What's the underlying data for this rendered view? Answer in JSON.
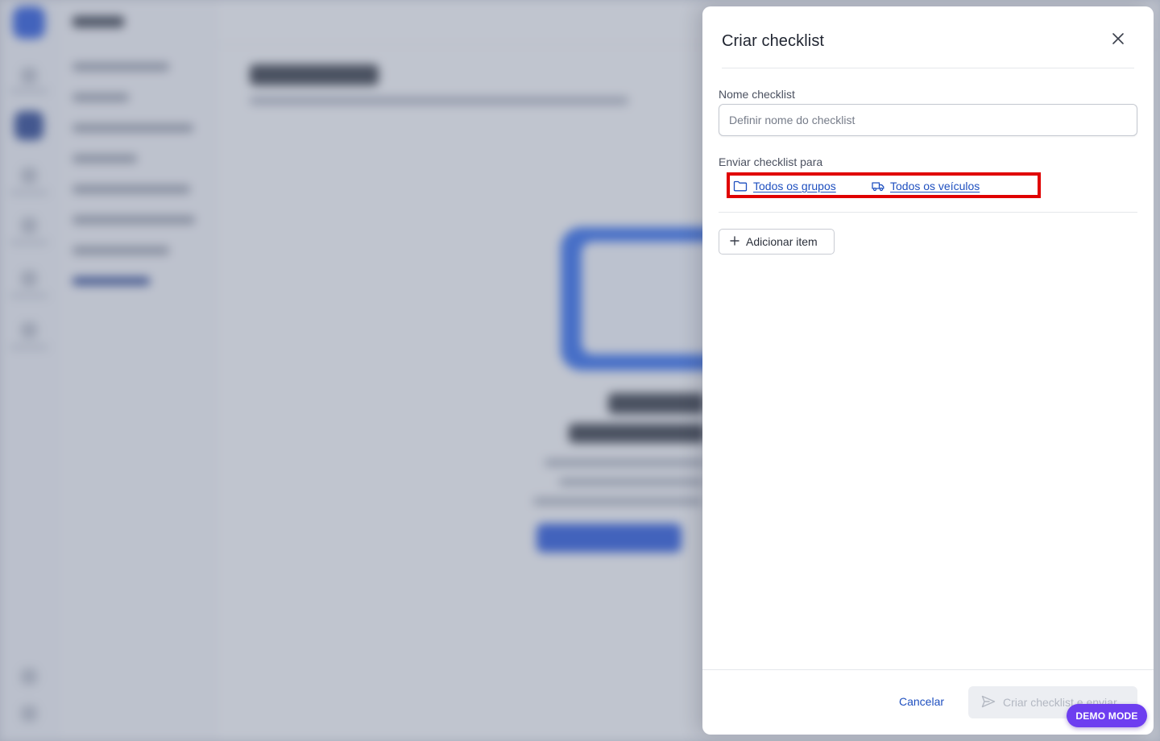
{
  "modal": {
    "title": "Criar checklist",
    "name_field": {
      "label": "Nome checklist",
      "placeholder": "Definir nome do checklist",
      "value": ""
    },
    "recipients": {
      "label": "Enviar checklist para",
      "groups_link": "Todos os grupos",
      "vehicles_link": "Todos os veículos"
    },
    "add_item_label": "Adicionar item",
    "footer": {
      "cancel_label": "Cancelar",
      "submit_label": "Criar checklist e enviar"
    }
  },
  "demo_badge": "DEMO MODE",
  "colors": {
    "link": "#1e4fbf",
    "highlight_box": "#e00000",
    "demo_badge": "#6d3ef0"
  },
  "icons": [
    "close-icon",
    "folder-icon",
    "truck-icon",
    "plus-icon",
    "send-icon"
  ]
}
